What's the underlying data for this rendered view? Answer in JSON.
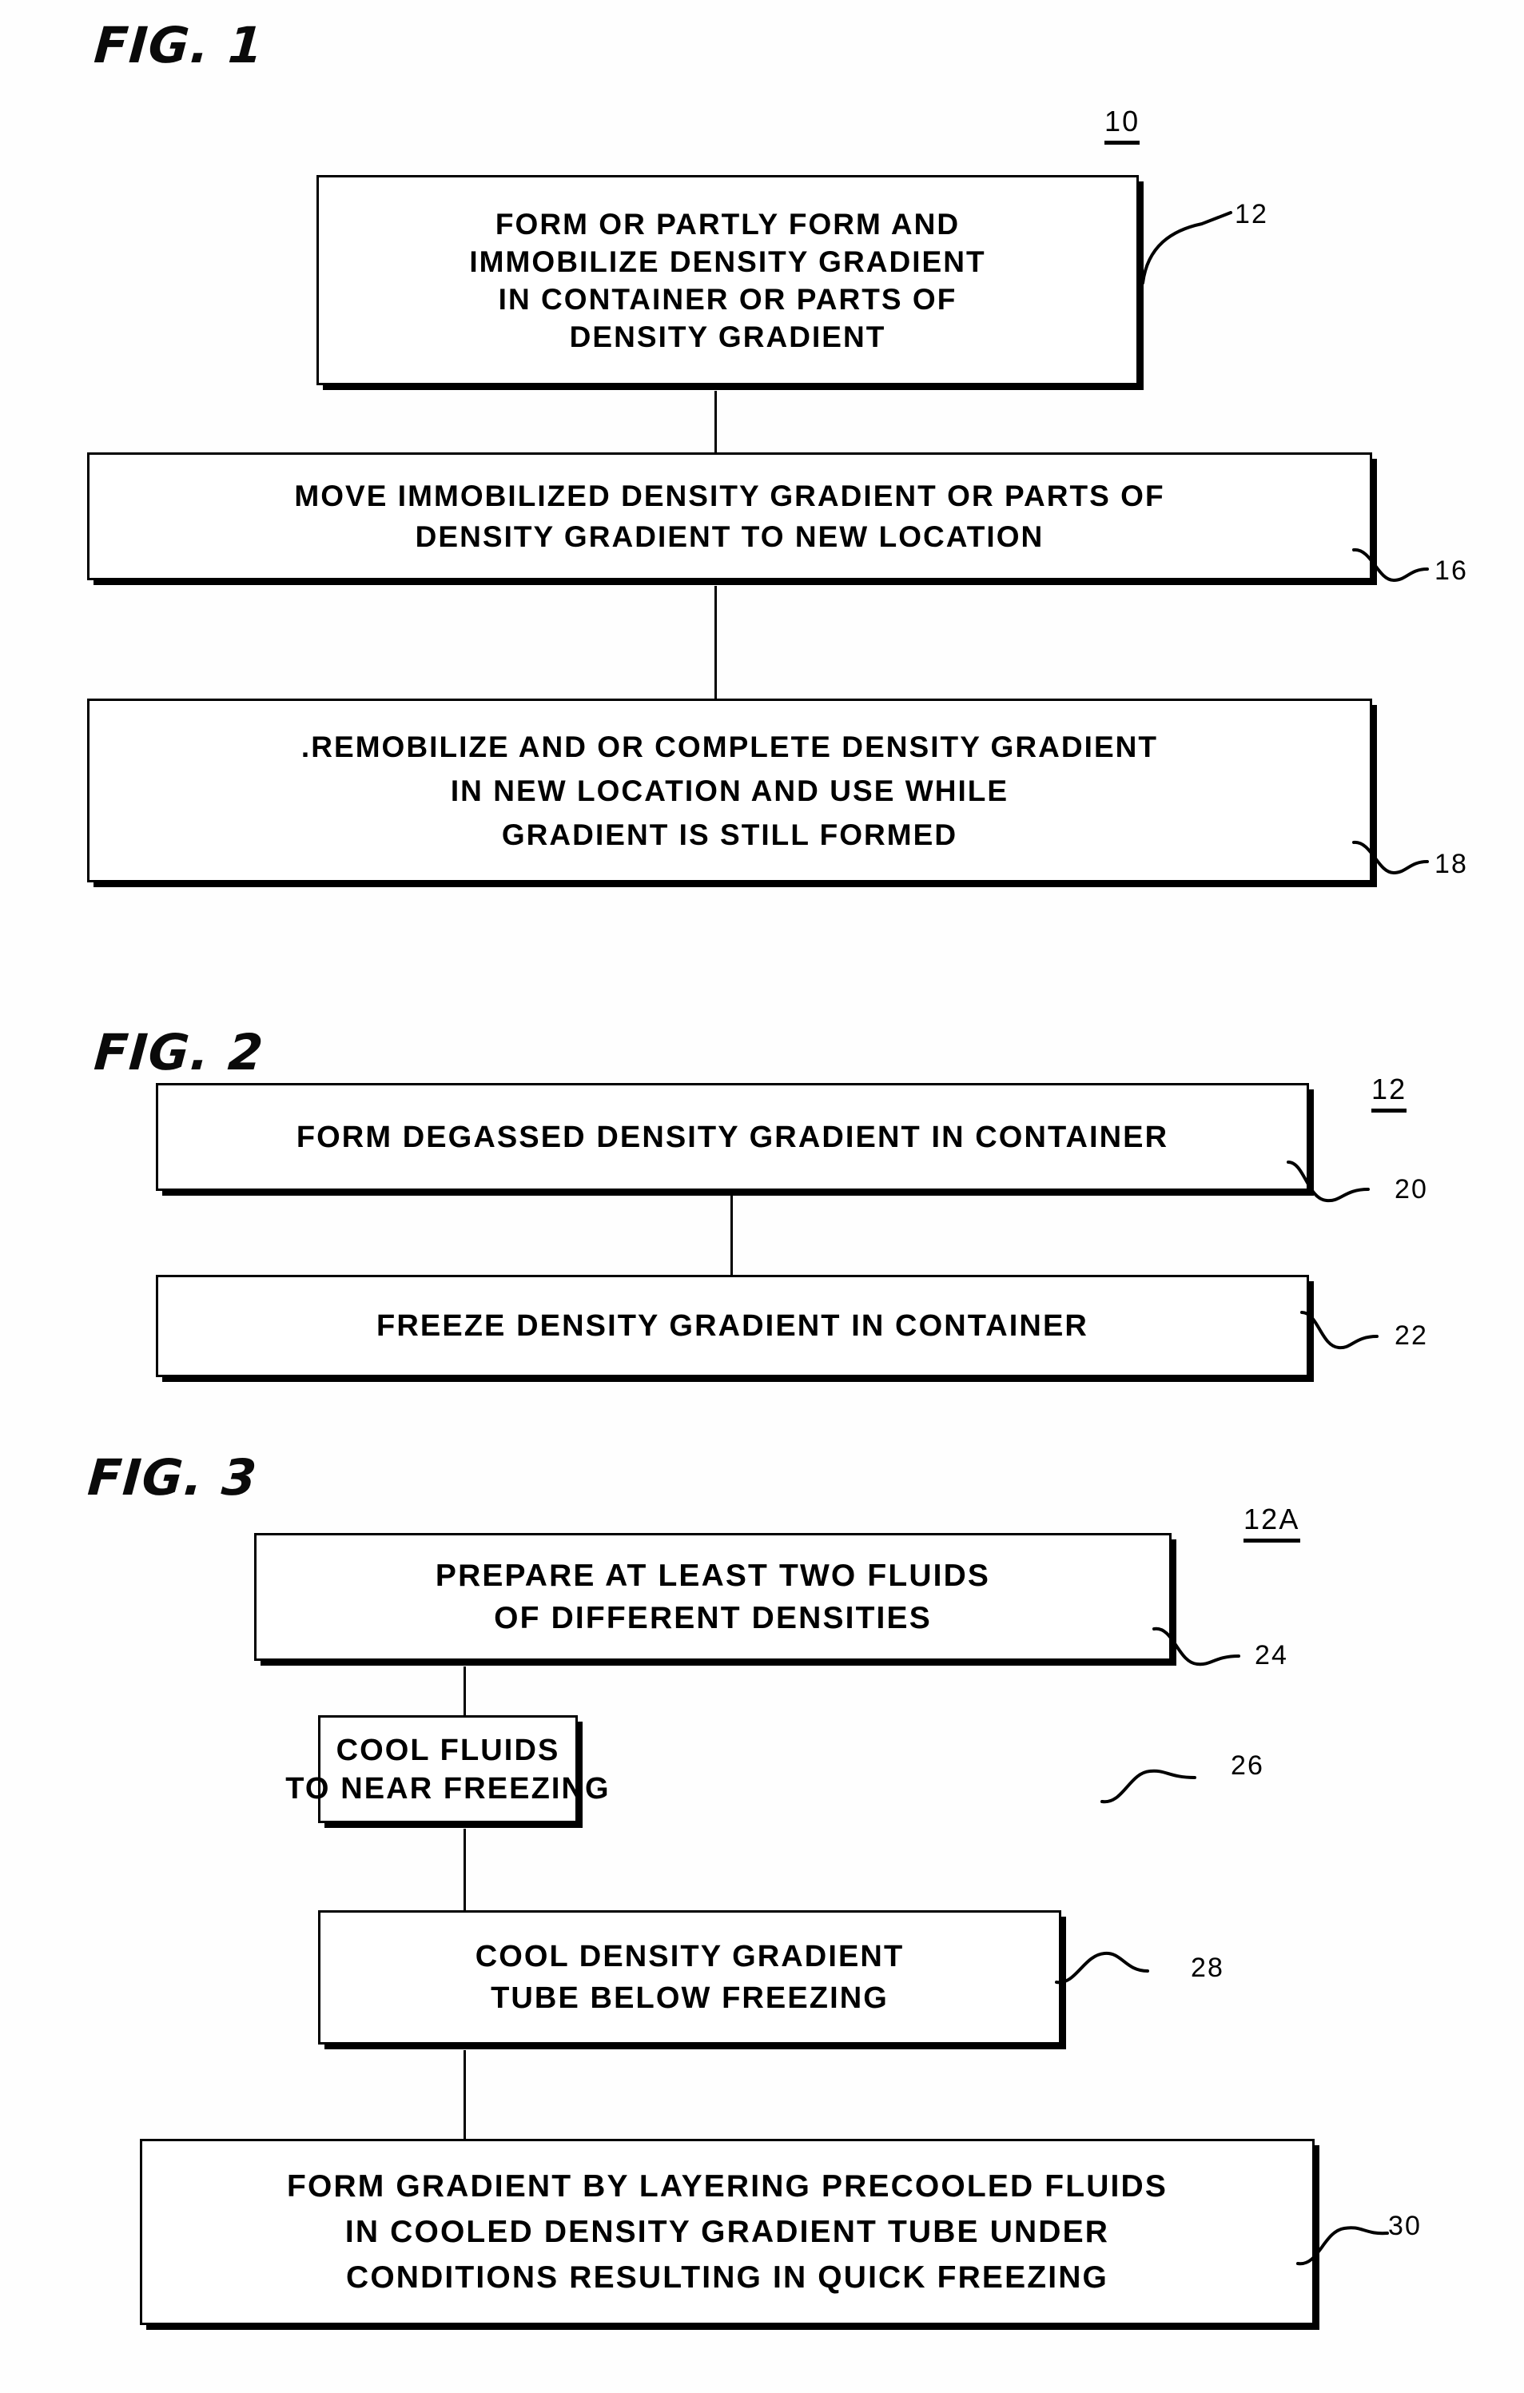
{
  "page": {
    "kind": "patent-flowchart-sheet",
    "ink_color": "#000000",
    "paper_color": "#fefefe"
  },
  "figures": [
    {
      "id": "fig1",
      "title": "FIG. 1",
      "assembly_ref": "10",
      "boxes": [
        {
          "ref": "12",
          "lines": [
            "FORM OR PARTLY FORM AND",
            "IMMOBILIZE DENSITY GRADIENT",
            "IN CONTAINER OR PARTS OF",
            "DENSITY GRADIENT"
          ]
        },
        {
          "ref": "16",
          "lines": [
            "MOVE IMMOBILIZED DENSITY GRADIENT OR PARTS OF",
            "DENSITY GRADIENT TO NEW LOCATION"
          ]
        },
        {
          "ref": "18",
          "lines": [
            ".REMOBILIZE  AND OR COMPLETE DENSITY GRADIENT",
            "IN NEW LOCATION AND USE WHILE",
            "GRADIENT  IS STILL FORMED"
          ]
        }
      ]
    },
    {
      "id": "fig2",
      "title": "FIG. 2",
      "assembly_ref": "12",
      "boxes": [
        {
          "ref": "20",
          "lines": [
            "FORM DEGASSED DENSITY GRADIENT IN CONTAINER"
          ]
        },
        {
          "ref": "22",
          "lines": [
            "FREEZE DENSITY GRADIENT IN CONTAINER"
          ]
        }
      ]
    },
    {
      "id": "fig3",
      "title": "FIG. 3",
      "assembly_ref": "12A",
      "boxes": [
        {
          "ref": "24",
          "lines": [
            "PREPARE AT LEAST  TWO FLUIDS",
            "OF DIFFERENT   DENSITIES"
          ]
        },
        {
          "ref": "26",
          "lines": [
            "COOL FLUIDS",
            "TO NEAR FREEZING"
          ]
        },
        {
          "ref": "28",
          "lines": [
            "COOL DENSITY GRADIENT",
            "TUBE  BELOW FREEZING"
          ]
        },
        {
          "ref": "30",
          "lines": [
            "FORM GRADIENT BY LAYERING PRECOOLED FLUIDS",
            "IN COOLED DENSITY GRADIENT TUBE UNDER",
            "CONDITIONS  RESULTING IN QUICK FREEZING"
          ]
        }
      ]
    }
  ]
}
